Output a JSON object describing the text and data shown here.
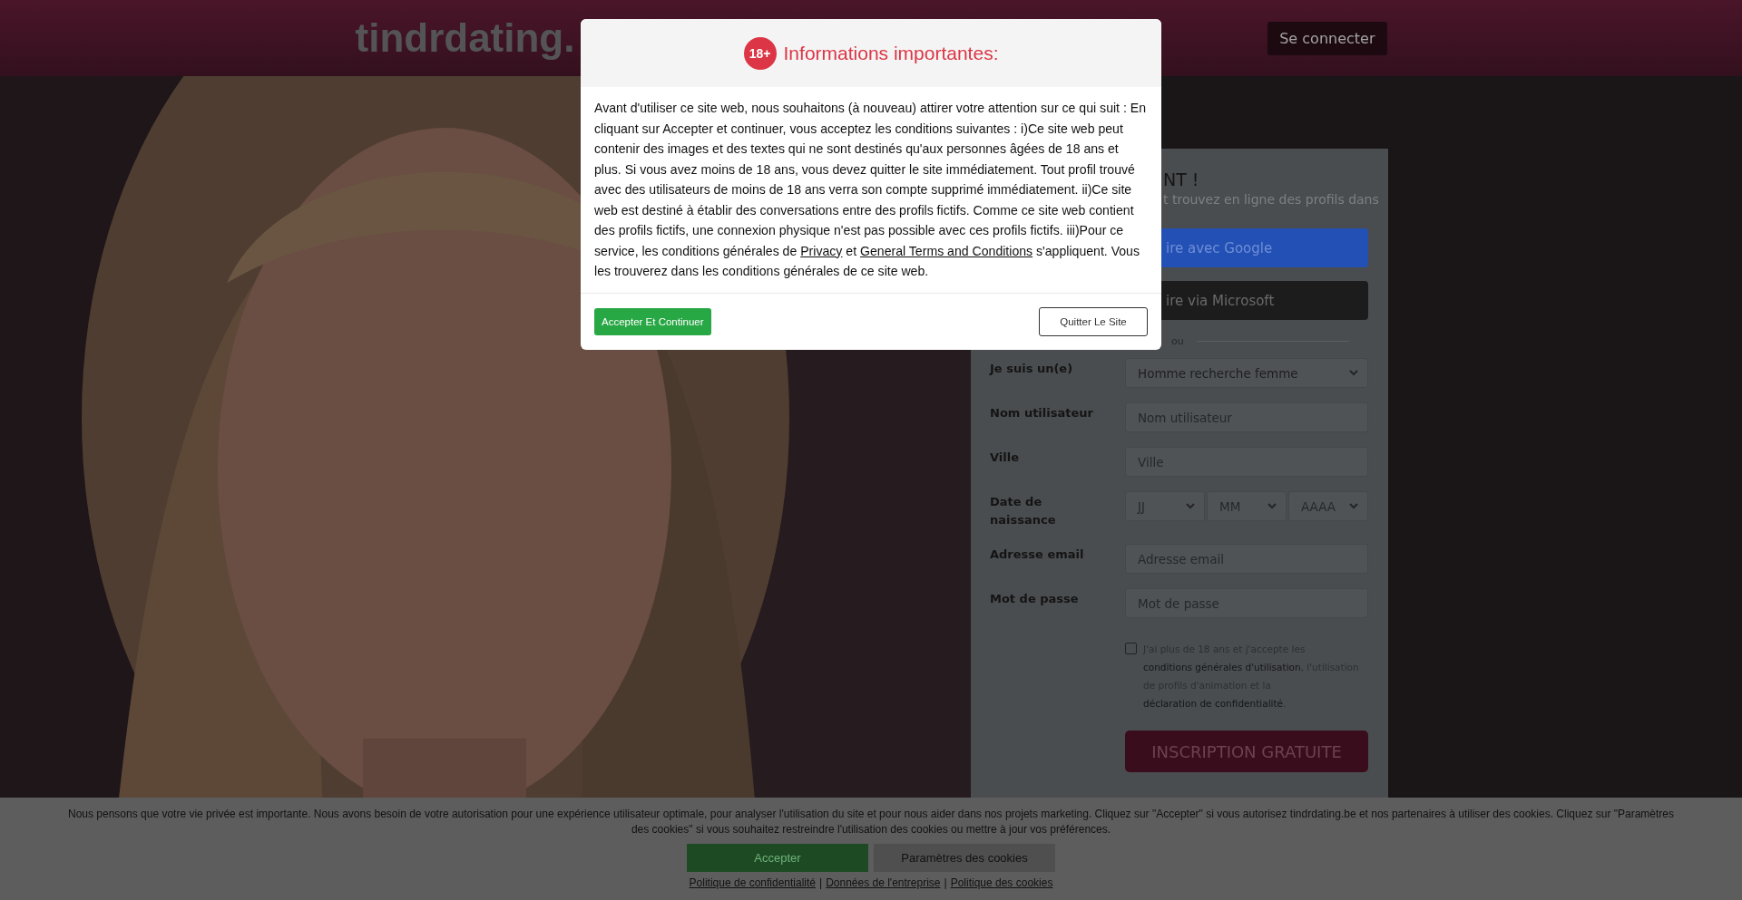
{
  "header": {
    "logo": "tindrdating.",
    "login_button": "Se connecter"
  },
  "signup": {
    "title": "NT !",
    "subtitle": "t trouvez en ligne des profils dans",
    "social_buttons": [
      {
        "kind": "google",
        "label": "ire avec Google"
      },
      {
        "kind": "microsoft",
        "label": "ire via Microsoft"
      }
    ],
    "divider": "ou",
    "fields": [
      {
        "kind": "select",
        "label": "Je suis un(e)",
        "value": "Homme recherche femme"
      },
      {
        "kind": "input",
        "label": "Nom utilisateur",
        "placeholder": "Nom utilisateur"
      },
      {
        "kind": "input",
        "label": "Ville",
        "placeholder": "Ville"
      },
      {
        "kind": "date",
        "label": "Date de naissance",
        "parts": [
          "JJ",
          "MM",
          "AAAA"
        ]
      },
      {
        "kind": "input",
        "label": "Adresse email",
        "placeholder": "Adresse email"
      },
      {
        "kind": "input",
        "label": "Mot de passe",
        "placeholder": "Mot de passe"
      }
    ],
    "consent": {
      "checked": false,
      "segments": [
        {
          "text": "J'ai plus de 18 ans et j'accepte les ",
          "kind": "text"
        },
        {
          "text": "conditions générales d'utilisation",
          "kind": "link"
        },
        {
          "text": ", l'utilisation de profils d'animation et la ",
          "kind": "text"
        },
        {
          "text": "déclaration de confidentialité",
          "kind": "link"
        },
        {
          "text": ".",
          "kind": "text"
        }
      ]
    },
    "submit": "INSCRIPTION GRATUITE"
  },
  "modal": {
    "badge": "18+",
    "title": "Informations importantes:",
    "body": [
      {
        "text": "Avant d'utiliser ce site web, nous souhaitons (à nouveau) attirer votre attention sur ce qui suit : En cliquant sur Accepter et continuer, vous acceptez les conditions suivantes : i)Ce site web peut contenir des images et des textes qui ne sont destinés qu'aux personnes âgées de 18 ans et plus. Si vous avez moins de 18 ans, vous devez quitter le site immédiatement. Tout profil trouvé avec des utilisateurs de moins de 18 ans verra son compte supprimé immédiatement. ii)Ce site web est destiné à établir des conversations entre des profils fictifs. Comme ce site web contient des profils fictifs, une connexion physique n'est pas possible avec ces profils fictifs. iii)Pour ce service, les conditions générales de ",
        "kind": "text"
      },
      {
        "text": "Privacy",
        "kind": "link"
      },
      {
        "text": " et ",
        "kind": "text"
      },
      {
        "text": "General Terms and Conditions",
        "kind": "link"
      },
      {
        "text": " s'appliquent. Vous les trouverez dans les conditions générales de ce site web.",
        "kind": "text"
      }
    ],
    "accept_button": "Accepter Et Continuer",
    "quit_button": "Quitter Le Site"
  },
  "cookie_banner": {
    "text": "Nous pensons que votre vie privée est importante. Nous avons besoin de votre autorisation pour une expérience utilisateur optimale, pour analyser l'utilisation du site et pour nous aider dans nos projets marketing. Cliquez sur \"Accepter\" si vous autorisez tindrdating.be et nos partenaires à utiliser des cookies. Cliquez sur \"Paramètres des cookies\" si vous souhaitez restreindre l'utilisation des cookies ou mettre à jour vos préférences.",
    "buttons": [
      {
        "kind": "primary",
        "label": "Accepter"
      },
      {
        "kind": "secondary",
        "label": "Paramètres des cookies"
      }
    ],
    "links": [
      {
        "kind": "link",
        "text": "Politique de confidentialité"
      },
      {
        "kind": "separator",
        "text": "|"
      },
      {
        "kind": "link",
        "text": "Données de l'entreprise"
      },
      {
        "kind": "separator",
        "text": "|"
      },
      {
        "kind": "link",
        "text": "Politique des cookies"
      }
    ]
  }
}
